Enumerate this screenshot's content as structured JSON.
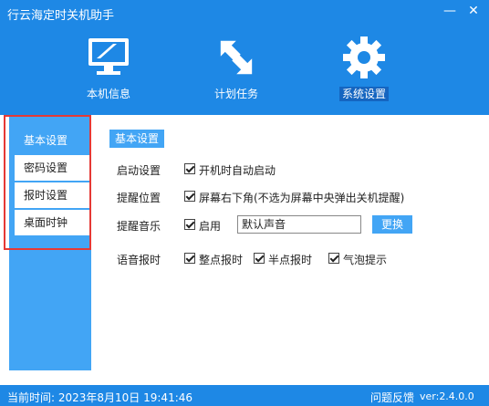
{
  "window": {
    "title": "行云海定时关机助手"
  },
  "nav": {
    "items": [
      {
        "label": "本机信息",
        "icon": "monitor-icon"
      },
      {
        "label": "计划任务",
        "icon": "arrows-icon"
      },
      {
        "label": "系统设置",
        "icon": "gear-icon",
        "active": true
      }
    ]
  },
  "sidebar": {
    "items": [
      {
        "label": "基本设置",
        "active": true
      },
      {
        "label": "密码设置"
      },
      {
        "label": "报时设置"
      },
      {
        "label": "桌面时钟"
      }
    ]
  },
  "main": {
    "section_title": "基本设置",
    "startup": {
      "label": "启动设置",
      "option": "开机时自动启动",
      "checked": true
    },
    "reminder_pos": {
      "label": "提醒位置",
      "option": "屏幕右下角(不选为屏幕中央弹出关机提醒)",
      "checked": true
    },
    "reminder_music": {
      "label": "提醒音乐",
      "option": "启用",
      "checked": true,
      "value": "默认声音",
      "change_label": "更换"
    },
    "voice": {
      "label": "语音报时",
      "options": [
        {
          "label": "整点报时",
          "checked": true
        },
        {
          "label": "半点报时",
          "checked": true
        },
        {
          "label": "气泡提示",
          "checked": true
        }
      ]
    }
  },
  "status": {
    "time": "当前时间: 2023年8月10日  19:41:46",
    "feedback": "问题反馈",
    "version": "ver:2.4.0.0"
  },
  "colors": {
    "brand": "#1e88e5",
    "accent": "#42a5f5",
    "highlight_border": "#e53935"
  }
}
